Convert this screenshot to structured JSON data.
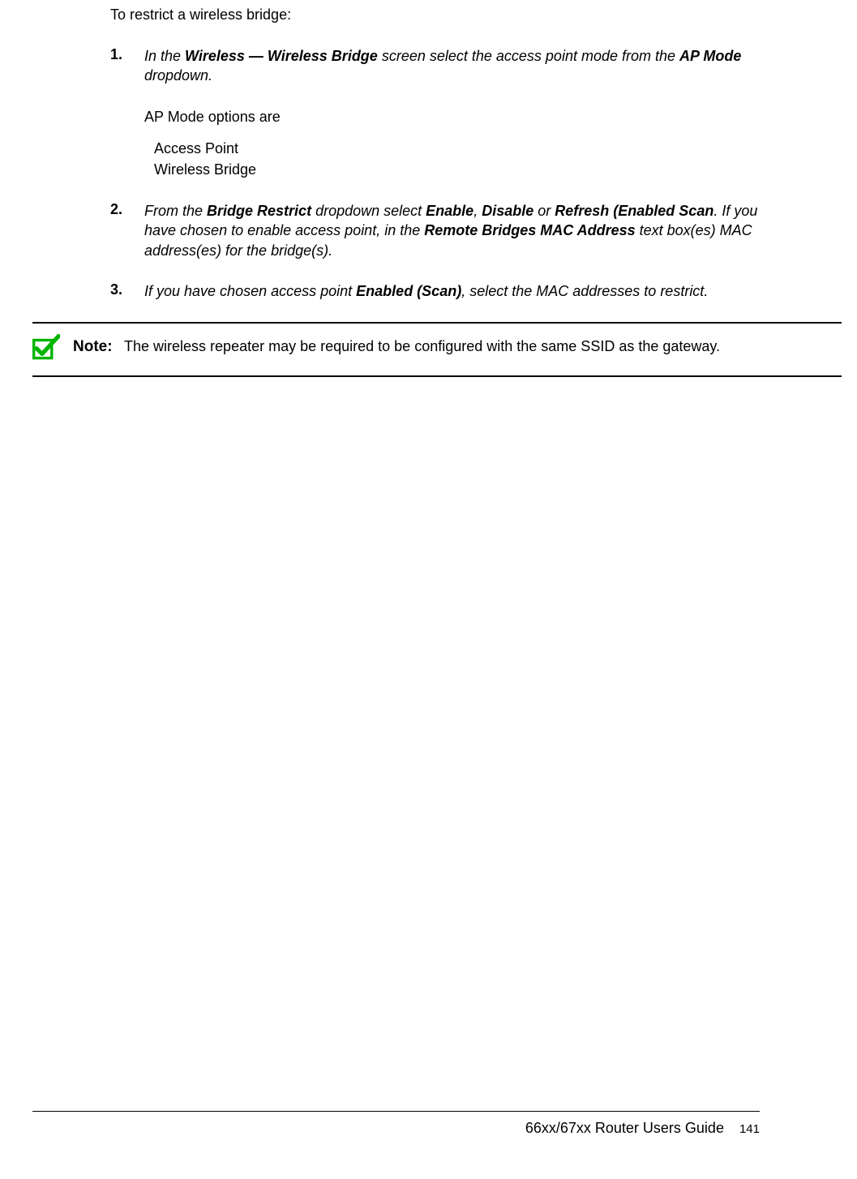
{
  "intro": "To restrict a wireless bridge:",
  "steps": [
    {
      "number": "1.",
      "segments": [
        {
          "text": "In the ",
          "style": "italic"
        },
        {
          "text": "Wireless — Wireless Bridge",
          "style": "bold-italic"
        },
        {
          "text": " screen select the access point mode from the ",
          "style": "italic"
        },
        {
          "text": "AP Mode",
          "style": "bold-italic"
        },
        {
          "text": " dropdown.",
          "style": "italic"
        }
      ],
      "subtext": "AP Mode options are",
      "options": [
        "Access Point",
        "Wireless Bridge"
      ]
    },
    {
      "number": "2.",
      "segments": [
        {
          "text": "From the ",
          "style": "italic"
        },
        {
          "text": "Bridge Restrict",
          "style": "bold-italic"
        },
        {
          "text": " dropdown select ",
          "style": "italic"
        },
        {
          "text": "Enable",
          "style": "bold-italic"
        },
        {
          "text": ", ",
          "style": "italic"
        },
        {
          "text": "Disable",
          "style": "bold-italic"
        },
        {
          "text": " or ",
          "style": "italic"
        },
        {
          "text": "Refresh (Enabled Scan",
          "style": "bold-italic"
        },
        {
          "text": ". If you have chosen to enable access point, in the ",
          "style": "italic"
        },
        {
          "text": "Remote Bridges MAC Address",
          "style": "bold-italic"
        },
        {
          "text": " text box(es) MAC address(es) for the bridge(s).",
          "style": "italic"
        }
      ]
    },
    {
      "number": "3.",
      "segments": [
        {
          "text": "If you have chosen access point ",
          "style": "italic"
        },
        {
          "text": "Enabled (Scan)",
          "style": "bold-italic"
        },
        {
          "text": ", select the MAC addresses to restrict.",
          "style": "italic"
        }
      ]
    }
  ],
  "note": {
    "label": "Note:",
    "text": "The wireless repeater may be required to be configured with the same SSID as the gateway."
  },
  "footer": {
    "guide": "66xx/67xx Router Users Guide",
    "page": "141"
  }
}
